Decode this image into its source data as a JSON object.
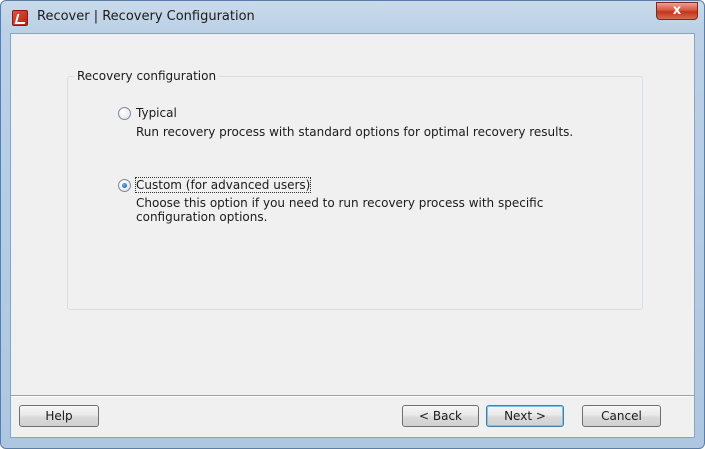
{
  "window": {
    "title": "Recover | Recovery Configuration",
    "close_glyph": "x"
  },
  "group": {
    "legend": "Recovery configuration"
  },
  "options": [
    {
      "label": "Typical",
      "description": "Run recovery process with standard options for optimal recovery results.",
      "selected": false
    },
    {
      "label": "Custom (for advanced users)",
      "description": "Choose this option if you need to run recovery process with specific configuration options.",
      "selected": true
    }
  ],
  "buttons": {
    "help": "Help",
    "back": "< Back",
    "next": "Next >",
    "cancel": "Cancel"
  },
  "colors": {
    "accent": "#3c7fb1",
    "close": "#c4341c"
  },
  "icons": {
    "app": "recover-app-icon",
    "close": "close-icon"
  }
}
